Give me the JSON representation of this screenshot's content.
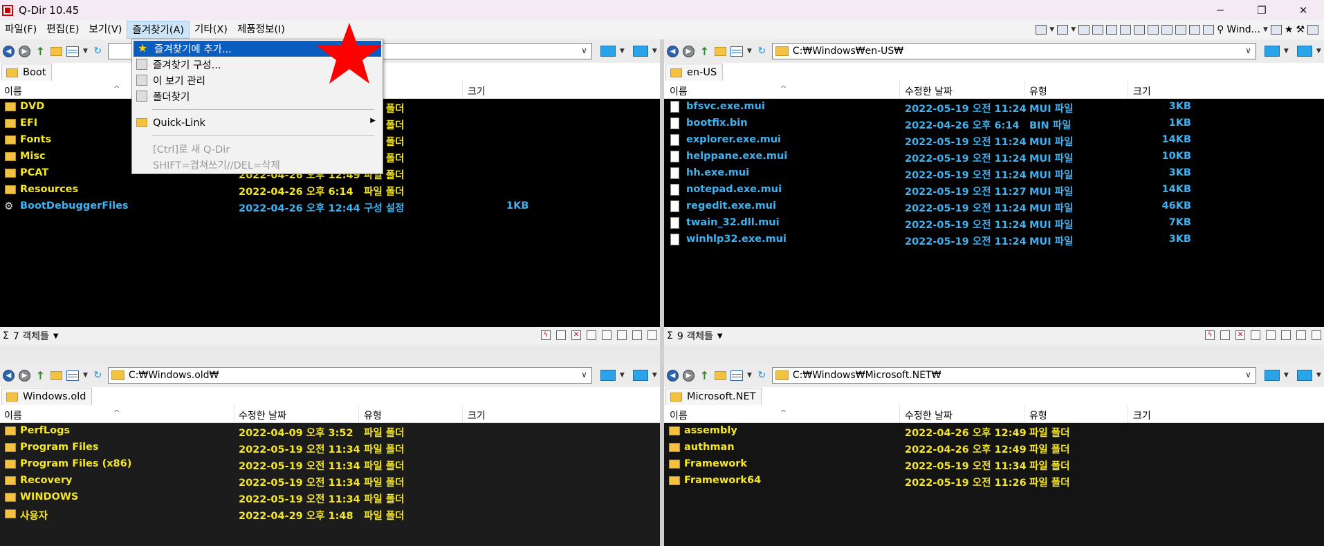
{
  "window": {
    "title": "Q-Dir 10.45",
    "minimize": "─",
    "maximize": "❐",
    "close": "✕"
  },
  "menubar": {
    "items": [
      "파일(F)",
      "편집(E)",
      "보기(V)",
      "즐겨찾기(A)",
      "기타(X)",
      "제품정보(I)"
    ],
    "active_index": 3
  },
  "toolbar_right": {
    "wind_label": "Wind..."
  },
  "favorites_menu": {
    "items": [
      {
        "label": "즐겨찾기에 추가...",
        "icon": "star-icon",
        "selected": true
      },
      {
        "label": "즐겨찾기 구성...",
        "icon": "favorites-icon"
      },
      {
        "label": "이 보기 관리",
        "icon": "favorites-icon"
      },
      {
        "label": "폴더찾기",
        "icon": "favorites-icon"
      }
    ],
    "quick_link": "Quick-Link",
    "hint1": "[Ctrl]로 새 Q-Dir",
    "hint2": "SHIFT=겹쳐쓰기//DEL=삭제"
  },
  "columns": {
    "name": "이름",
    "date": "수정한 날짜",
    "type": "유형",
    "size": "크기"
  },
  "panes": {
    "top_left": {
      "address": "",
      "tab": "Boot",
      "rows": [
        {
          "name": "DVD",
          "date": "",
          "type": "파일 폴더",
          "size": "",
          "kind": "folder"
        },
        {
          "name": "EFI",
          "date": "",
          "type": "파일 폴더",
          "size": "",
          "kind": "folder"
        },
        {
          "name": "Fonts",
          "date": "",
          "type": "파일 폴더",
          "size": "",
          "kind": "folder"
        },
        {
          "name": "Misc",
          "date": "",
          "type": "파일 폴더",
          "size": "",
          "kind": "folder"
        },
        {
          "name": "PCAT",
          "date": "2022-04-26 오후 12:49",
          "type": "파일 폴더",
          "size": "",
          "kind": "folder"
        },
        {
          "name": "Resources",
          "date": "2022-04-26 오후 6:14",
          "type": "파일 폴더",
          "size": "",
          "kind": "folder"
        },
        {
          "name": "BootDebuggerFiles",
          "date": "2022-04-26 오후 12:44",
          "type": "구성 설정",
          "size": "1KB",
          "kind": "config"
        }
      ],
      "status": "7 객체들"
    },
    "top_right": {
      "address": "C:₩Windows₩en-US₩",
      "tab": "en-US",
      "rows": [
        {
          "name": "bfsvc.exe.mui",
          "date": "2022-05-19 오전 11:24",
          "type": "MUI 파일",
          "size": "3KB"
        },
        {
          "name": "bootfix.bin",
          "date": "2022-04-26 오후 6:14",
          "type": "BIN 파일",
          "size": "1KB"
        },
        {
          "name": "explorer.exe.mui",
          "date": "2022-05-19 오전 11:24",
          "type": "MUI 파일",
          "size": "14KB"
        },
        {
          "name": "helppane.exe.mui",
          "date": "2022-05-19 오전 11:24",
          "type": "MUI 파일",
          "size": "10KB"
        },
        {
          "name": "hh.exe.mui",
          "date": "2022-05-19 오전 11:24",
          "type": "MUI 파일",
          "size": "3KB"
        },
        {
          "name": "notepad.exe.mui",
          "date": "2022-05-19 오전 11:27",
          "type": "MUI 파일",
          "size": "14KB"
        },
        {
          "name": "regedit.exe.mui",
          "date": "2022-05-19 오전 11:24",
          "type": "MUI 파일",
          "size": "46KB"
        },
        {
          "name": "twain_32.dll.mui",
          "date": "2022-05-19 오전 11:24",
          "type": "MUI 파일",
          "size": "7KB"
        },
        {
          "name": "winhlp32.exe.mui",
          "date": "2022-05-19 오전 11:24",
          "type": "MUI 파일",
          "size": "3KB"
        }
      ],
      "status": "9 객체들"
    },
    "bottom_left": {
      "address": "C:₩Windows.old₩",
      "tab": "Windows.old",
      "rows": [
        {
          "name": "PerfLogs",
          "date": "2022-04-09 오후 3:52",
          "type": "파일 폴더",
          "size": ""
        },
        {
          "name": "Program Files",
          "date": "2022-05-19 오전 11:34",
          "type": "파일 폴더",
          "size": ""
        },
        {
          "name": "Program Files (x86)",
          "date": "2022-05-19 오전 11:34",
          "type": "파일 폴더",
          "size": ""
        },
        {
          "name": "Recovery",
          "date": "2022-05-19 오전 11:34",
          "type": "파일 폴더",
          "size": ""
        },
        {
          "name": "WINDOWS",
          "date": "2022-05-19 오전 11:34",
          "type": "파일 폴더",
          "size": ""
        },
        {
          "name": "사용자",
          "date": "2022-04-29 오후 1:48",
          "type": "파일 폴더",
          "size": ""
        }
      ]
    },
    "bottom_right": {
      "address": "C:₩Windows₩Microsoft.NET₩",
      "tab": "Microsoft.NET",
      "rows": [
        {
          "name": "assembly",
          "date": "2022-04-26 오후 12:49",
          "type": "파일 폴더",
          "size": ""
        },
        {
          "name": "authman",
          "date": "2022-04-26 오후 12:49",
          "type": "파일 폴더",
          "size": ""
        },
        {
          "name": "Framework",
          "date": "2022-05-19 오전 11:34",
          "type": "파일 폴더",
          "size": ""
        },
        {
          "name": "Framework64",
          "date": "2022-05-19 오전 11:26",
          "type": "파일 폴더",
          "size": ""
        }
      ]
    }
  },
  "colors": {
    "folder_text": "#f5e626",
    "file_text": "#3fb3f2",
    "selection": "#0a5dbf",
    "star": "#ff0000"
  }
}
